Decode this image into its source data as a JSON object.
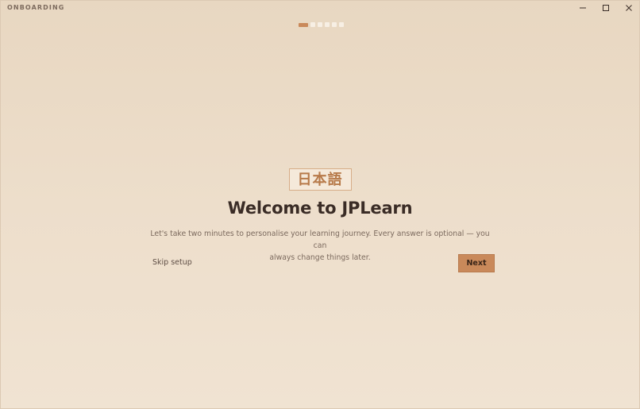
{
  "window": {
    "title": "ONBOARDING",
    "controls": [
      "minimize-icon",
      "maximize-icon",
      "close-icon"
    ]
  },
  "progress": {
    "total_steps": 6,
    "current_step": 1
  },
  "hero": {
    "logo_text": "日本語",
    "headline": "Welcome to JPLearn",
    "subtitle_line1": "Let's take two minutes to personalise your learning journey. Every answer is optional — you can",
    "subtitle_line2": "always change things later."
  },
  "actions": {
    "skip_label": "Skip setup",
    "next_label": "Next"
  },
  "colors": {
    "accent": "#c9895a",
    "background": "#ecdcc7",
    "text_dark": "#3a2c26",
    "text_muted": "#7c6a5e"
  }
}
